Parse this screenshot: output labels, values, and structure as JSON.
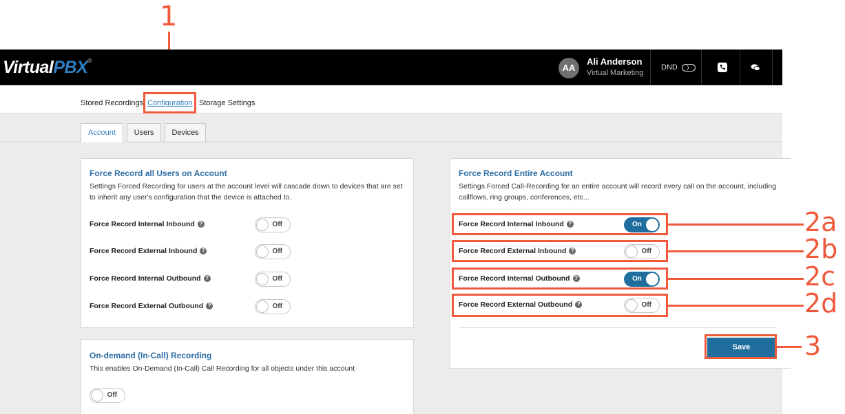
{
  "brand": {
    "logo_virtual": "Virtual",
    "logo_pbx": "PBX",
    "logo_reg": "®"
  },
  "header": {
    "avatar_initials": "AA",
    "user_name": "Ali Anderson",
    "user_org": "Virtual Marketing",
    "dnd_label": "DND",
    "icons": [
      "phone-icon",
      "chat-icon"
    ]
  },
  "subnav": {
    "items": [
      {
        "label": "Stored Recordings",
        "active": false
      },
      {
        "label": "Configuration",
        "active": true
      },
      {
        "label": "Storage Settings",
        "active": false
      }
    ]
  },
  "tabs": [
    {
      "label": "Account",
      "active": true
    },
    {
      "label": "Users",
      "active": false
    },
    {
      "label": "Devices",
      "active": false
    }
  ],
  "users_card": {
    "title": "Force Record all Users on Account",
    "description": "Settings Forced Recording for users at the account level will cascade down to devices that are set to inherit any user's configuration that the device is attached to.",
    "rows": [
      {
        "label": "Force Record Internal Inbound",
        "state": "Off"
      },
      {
        "label": "Force Record External Inbound",
        "state": "Off"
      },
      {
        "label": "Force Record Internal Outbound",
        "state": "Off"
      },
      {
        "label": "Force Record External Outbound",
        "state": "Off"
      }
    ]
  },
  "ondemand_card": {
    "title": "On-demand (In-Call) Recording",
    "description": "This enables On-Demand (In-Call) Call Recording for all objects under this account",
    "state": "Off"
  },
  "account_card": {
    "title": "Force Record Entire Account",
    "description": "Settings Forced Call-Recording for an entire account will record every call on the account, including callflows, ring groups, conferences, etc...",
    "rows": [
      {
        "label": "Force Record Internal Inbound",
        "state": "On"
      },
      {
        "label": "Force Record External Inbound",
        "state": "Off"
      },
      {
        "label": "Force Record Internal Outbound",
        "state": "On"
      },
      {
        "label": "Force Record External Outbound",
        "state": "Off"
      }
    ],
    "save_label": "Save"
  },
  "callouts": {
    "c1": "1",
    "c2a": "2a",
    "c2b": "2b",
    "c2c": "2c",
    "c2d": "2d",
    "c3": "3",
    "color": "#f05a3c"
  },
  "colors": {
    "accent": "#2e7fc1",
    "toggle_on": "#1f6e9d",
    "header_bg": "#000000"
  }
}
